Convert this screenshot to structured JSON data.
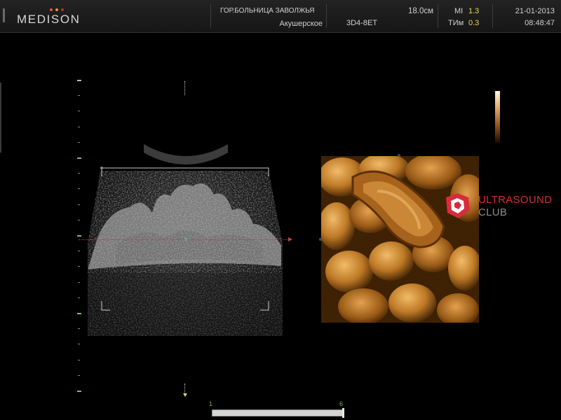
{
  "header": {
    "brand": "MEDISON",
    "logo_dot_colors": [
      "#e05a32",
      "#e0a020",
      "#b83020"
    ],
    "hospital": "ГОР.БОЛЬНИЦА ЗАВОЛЖЬЯ",
    "preset": "Акушерское",
    "probe": "3D4-8ET",
    "depth": "18.0см",
    "mi_label": "MI",
    "mi_value": "1.3",
    "tim_label": "ТИм",
    "tim_value": "0.3",
    "date": "21-01-2013",
    "time": "08:48:47",
    "value_color": "#e8d84a"
  },
  "watermark": {
    "line1": "ULTRASOUND",
    "line2": "CLUB",
    "brand_color": "#d82c3c"
  },
  "slider": {
    "min_label": "1",
    "max_label": "6",
    "value_fraction": 1.0
  },
  "colors": {
    "render_tone": "#d08a30",
    "tick_accent": "#7fbf5a",
    "reference_line": "#c04848"
  }
}
